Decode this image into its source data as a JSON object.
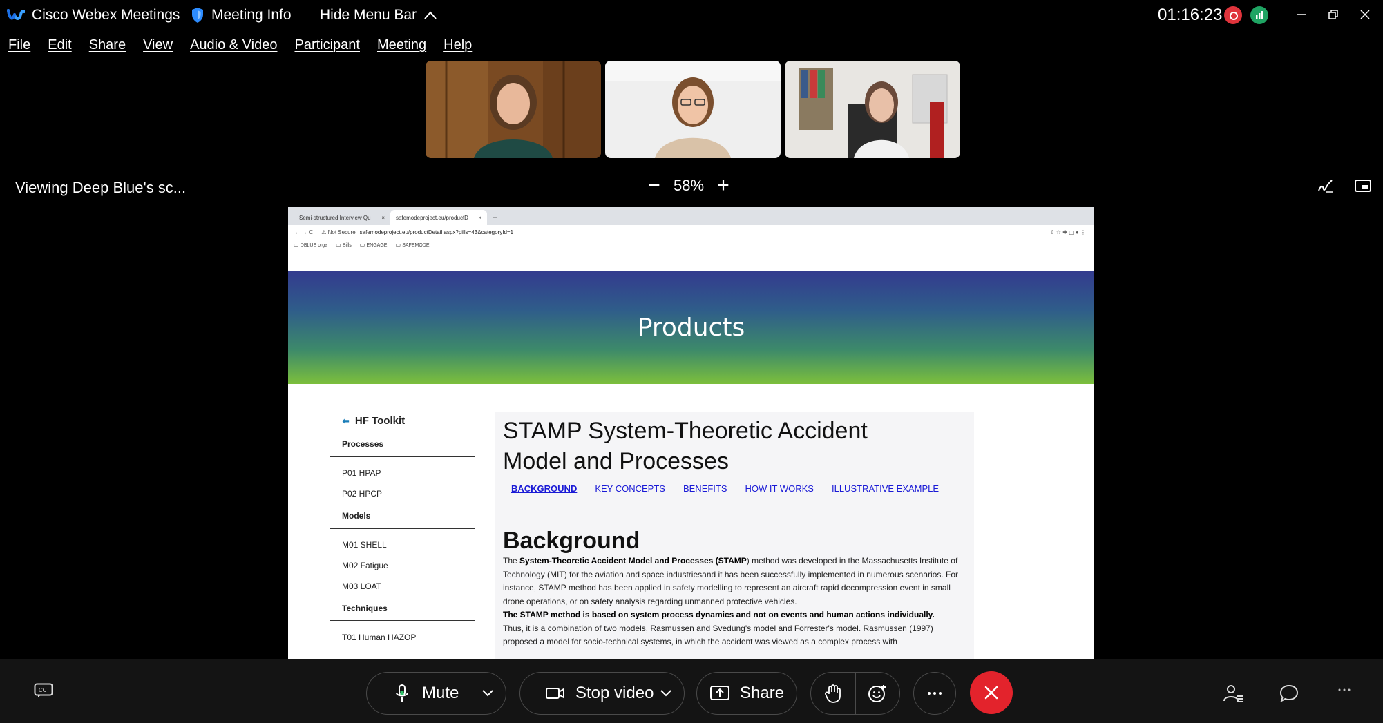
{
  "titlebar": {
    "app_name": "Cisco Webex Meetings",
    "meeting_info": "Meeting Info",
    "hide_menu": "Hide Menu Bar",
    "timer": "01:16:23"
  },
  "menu": [
    "File",
    "Edit",
    "Share",
    "View",
    "Audio & Video",
    "Participant",
    "Meeting",
    "Help"
  ],
  "share": {
    "viewing": "Viewing Deep Blue's sc...",
    "zoom_out": "−",
    "zoom_level": "58%",
    "zoom_in": "+"
  },
  "browser": {
    "tabs": [
      {
        "label": "Semi-structured Interview Qu",
        "close": "×"
      },
      {
        "label": "safemodeproject.eu/productD",
        "close": "×"
      }
    ],
    "new_tab": "+",
    "nav": "←  →  C",
    "not_secure": "⚠ Not Secure",
    "url": "safemodeproject.eu/productDetail.aspx?pills=43&categoryId=1",
    "addr_icons": "⇧ ☆ ✚ ▢ ●  ⋮",
    "bookmarks": [
      "DBLUE orga",
      "Bills",
      "ENGAGE",
      "SAFEMODE"
    ]
  },
  "site": {
    "hero_title": "Products",
    "sidebar": {
      "heading": "HF Toolkit",
      "sections": [
        {
          "title": "Processes",
          "items": [
            "P01 HPAP",
            "P02 HPCP"
          ]
        },
        {
          "title": "Models",
          "items": [
            "M01 SHELL",
            "M02 Fatigue",
            "M03 LOAT"
          ]
        },
        {
          "title": "Techniques",
          "items": [
            "T01 Human HAZOP"
          ]
        }
      ]
    },
    "article": {
      "title_line1": "STAMP System-Theoretic Accident",
      "title_line2": "Model and Processes",
      "tabs": [
        "BACKGROUND",
        "KEY CONCEPTS",
        "BENEFITS",
        "HOW IT WORKS",
        "ILLUSTRATIVE EXAMPLE"
      ],
      "section_title": "Background",
      "p1_a": "The ",
      "p1_bold": "System-Theoretic Accident Model and Processes (STAMP",
      "p1_b": ") method was developed in the Massachusetts Institute of Technology (MIT) for the aviation and space industriesand it has been successfully implemented in numerous scenarios. For instance, STAMP method has been applied in safety modelling to represent an aircraft rapid decompression event in small drone operations, or on safety analysis regarding unmanned protective vehicles.",
      "p2_bold": "The STAMP method is based on system process dynamics and not on events and human actions individually.",
      "p3": "Thus, it is a combination of two models, Rasmussen and Svedung's model and Forrester's model. Rasmussen (1997) proposed a model for socio-technical systems, in which the accident was viewed as a complex process with"
    }
  },
  "toolbar": {
    "mute": "Mute",
    "stop_video": "Stop video",
    "share": "Share"
  },
  "colors": {
    "end_call": "#e3232c",
    "recording": "#e0343c",
    "network": "#1fa463",
    "link_blue": "#1a1ad6"
  }
}
